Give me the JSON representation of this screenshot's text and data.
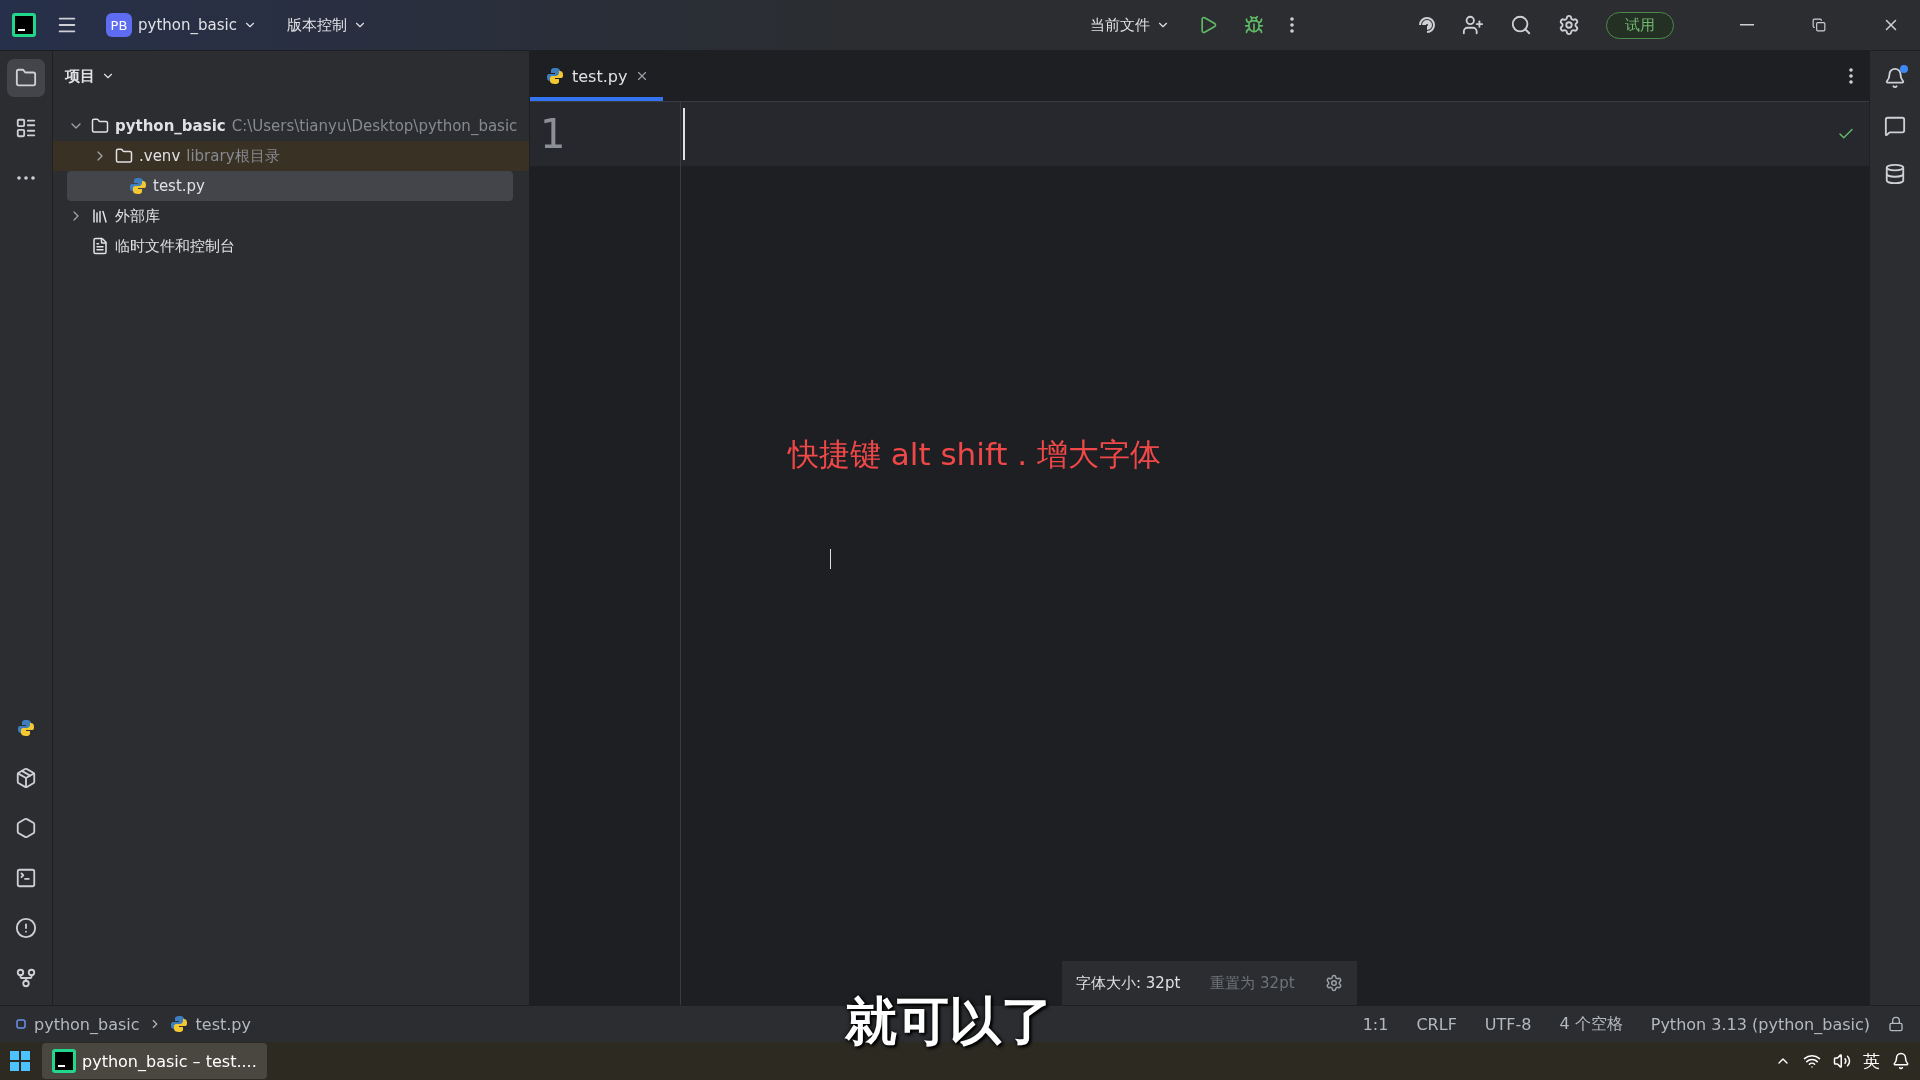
{
  "title_bar": {
    "project_badge": "PB",
    "project": "python_basic",
    "vcs": "版本控制",
    "run_config": "当前文件",
    "trial_button": "试用"
  },
  "project_panel": {
    "title": "项目",
    "tree": [
      {
        "label": "python_basic",
        "hint": "C:\\Users\\tianyu\\Desktop\\python_basic",
        "kind": "folder",
        "expanded": true,
        "selected": false,
        "children": [
          {
            "label": ".venv",
            "hint": "library根目录",
            "kind": "library_root",
            "expanded": false,
            "selected": false
          },
          {
            "label": "test.py",
            "kind": "python_file",
            "selected": true
          }
        ]
      },
      {
        "label": "外部库",
        "kind": "libraries",
        "expanded": false,
        "selected": false
      },
      {
        "label": "临时文件和控制台",
        "kind": "scratches",
        "selected": false
      }
    ]
  },
  "editor": {
    "tabs": [
      {
        "label": "test.py",
        "selected": true
      }
    ],
    "line_numbers": [
      "1"
    ],
    "annotation": "快捷键 alt shift . 增大字体",
    "font_popup": {
      "size": "字体大小: 32pt",
      "reset": "重置为 32pt"
    }
  },
  "breadcrumbs": [
    "python_basic",
    "test.py"
  ],
  "status_bar": [
    "1:1",
    "CRLF",
    "UTF-8",
    "4 个空格",
    "Python 3.13 (python_basic)"
  ],
  "subtitle": "就可以了",
  "taskbar": {
    "app": "python_basic – test....",
    "input_method": "英"
  }
}
